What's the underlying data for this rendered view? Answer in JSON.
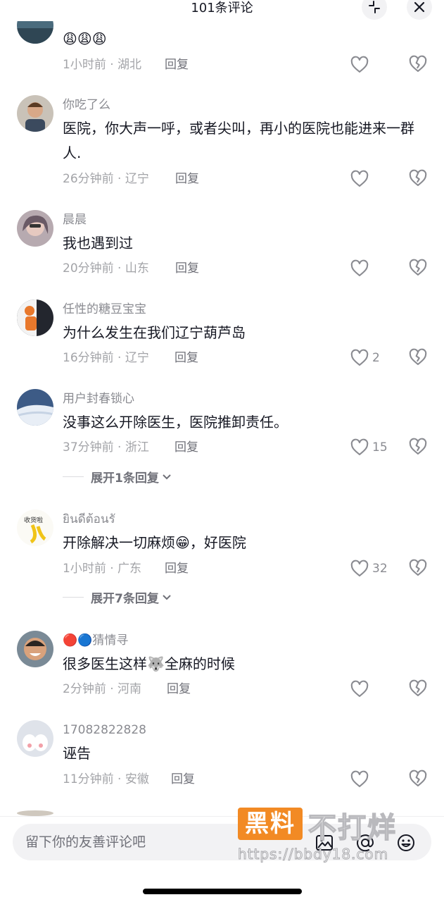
{
  "header": {
    "title": "101条评论"
  },
  "comments": [
    {
      "user": "",
      "text": "😩😩😩",
      "time": "1小时前",
      "location": "湖北",
      "reply": "回复",
      "likes": "",
      "avatar": "avatar-top"
    },
    {
      "user": "你吃了么",
      "text": "医院，你大声一呼，或者尖叫，再小的医院也能进来一群人.",
      "time": "26分钟前",
      "location": "辽宁",
      "reply": "回复",
      "likes": ""
    },
    {
      "user": "晨晨",
      "text": "我也遇到过",
      "time": "20分钟前",
      "location": "山东",
      "reply": "回复",
      "likes": ""
    },
    {
      "user": "任性的糖豆宝宝",
      "text": "为什么发生在我们辽宁葫芦岛",
      "time": "16分钟前",
      "location": "辽宁",
      "reply": "回复",
      "likes": "2"
    },
    {
      "user": "用户封春锁心",
      "text": "没事这么开除医生，医院推卸责任。",
      "time": "37分钟前",
      "location": "浙江",
      "reply": "回复",
      "likes": "15",
      "expand": "展开1条回复"
    },
    {
      "user": "ยินดีต้อนรั",
      "text": "开除解决一切麻烦😁，好医院",
      "time": "1小时前",
      "location": "广东",
      "reply": "回复",
      "likes": "32",
      "expand": "展开7条回复"
    },
    {
      "user": "🔴🔵猜情寻",
      "text": "很多医生这样🐺全麻的时候",
      "time": "2分钟前",
      "location": "河南",
      "reply": "回复",
      "likes": ""
    },
    {
      "user": "17082822828",
      "text": "诬告",
      "time": "11分钟前",
      "location": "安徽",
      "reply": "回复",
      "likes": ""
    }
  ],
  "input": {
    "placeholder": "留下你的友善评论吧"
  },
  "watermark": {
    "brand": "黑料",
    "slogan": "不打烊",
    "url": "https://bbdy18.com"
  },
  "icons": {
    "collapse": "collapse-icon",
    "close": "close-icon",
    "like": "heart-icon",
    "dislike": "broken-heart-icon",
    "image": "image-icon",
    "mention": "at-icon",
    "emoji": "emoji-icon"
  }
}
